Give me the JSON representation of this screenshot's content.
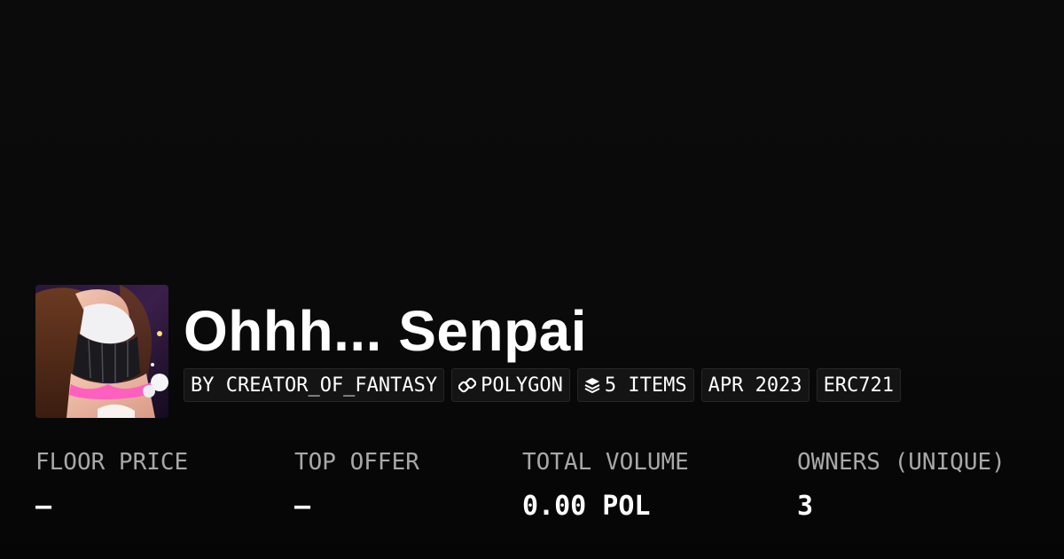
{
  "collection": {
    "title": "Ohhh... Senpai",
    "avatar_alt": "collection-artwork"
  },
  "chips": {
    "creator": "BY CREATOR_OF_FANTASY",
    "chain": "POLYGON",
    "chain_icon": "polygon-link-icon",
    "items": "5 ITEMS",
    "items_icon": "layers-icon",
    "date": "APR 2023",
    "standard": "ERC721"
  },
  "stats": {
    "floor_price": {
      "label": "FLOOR PRICE",
      "value": "–"
    },
    "top_offer": {
      "label": "TOP OFFER",
      "value": "–"
    },
    "total_volume": {
      "label": "TOTAL VOLUME",
      "value": "0.00 POL"
    },
    "owners": {
      "label": "OWNERS (UNIQUE)",
      "value": "3"
    }
  },
  "colors": {
    "background": "#0a0a0a",
    "chip_bg": "#141414",
    "chip_border": "#262626",
    "label": "#a8a8a8",
    "text": "#ffffff"
  }
}
